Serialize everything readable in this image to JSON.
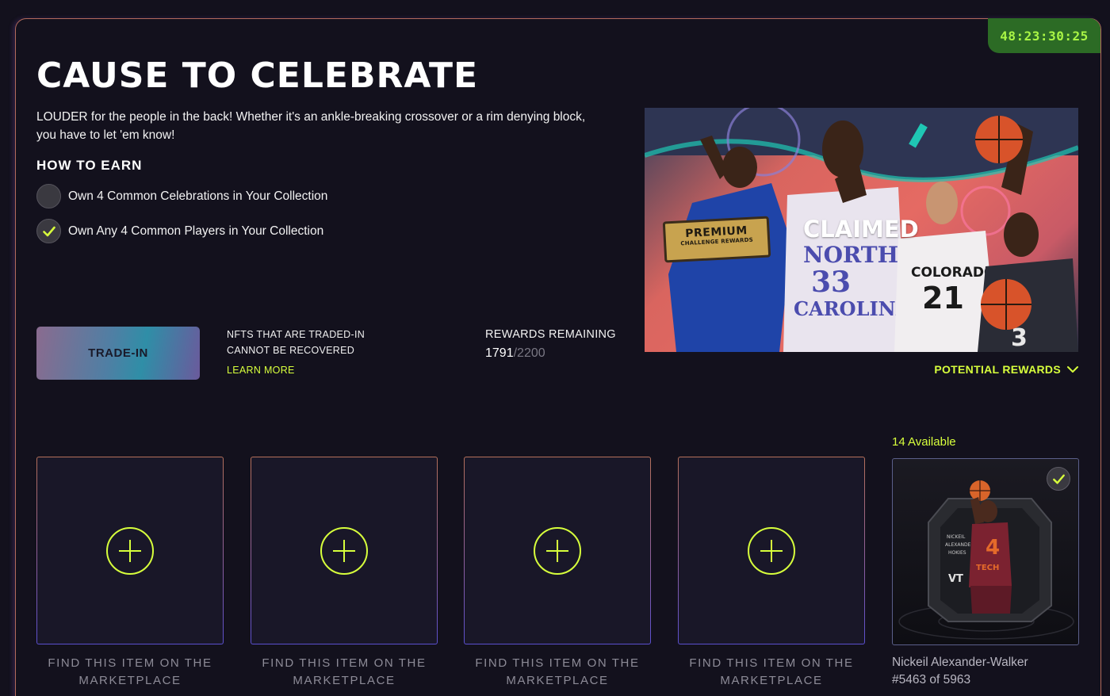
{
  "timer": "48:23:30:25",
  "title": "CAUSE TO CELEBRATE",
  "description": "LOUDER for the people in the back! Whether it's an ankle-breaking crossover or a rim denying block, you have to let 'em know!",
  "how_to_earn": {
    "heading": "HOW TO EARN",
    "requirements": [
      {
        "label": "Own 4 Common Celebrations in Your Collection",
        "completed": false
      },
      {
        "label": "Own Any 4 Common Players in Your Collection",
        "completed": true
      }
    ]
  },
  "trade_in": {
    "button_label": "TRADE-IN",
    "warning_line1": "NFTS THAT ARE TRADED-IN",
    "warning_line2": "CANNOT BE RECOVERED",
    "learn_more": "LEARN MORE"
  },
  "rewards": {
    "label": "REWARDS REMAINING",
    "remaining": "1791",
    "total": "/2200"
  },
  "hero": {
    "claimed_label": "CLAIMED",
    "premium_line1": "PREMIUM",
    "premium_line2": "CHALLENGE REWARDS",
    "jerseys": {
      "center_team": "NORTH CAROLINA",
      "center_number": "33",
      "right_team": "COLORADO",
      "right_number": "21",
      "far_right_number": "3"
    }
  },
  "potential_rewards": "POTENTIAL REWARDS",
  "slots": [
    {
      "caption_line1": "FIND THIS ITEM ON THE",
      "caption_line2": "MARKETPLACE"
    },
    {
      "caption_line1": "FIND THIS ITEM ON THE",
      "caption_line2": "MARKETPLACE"
    },
    {
      "caption_line1": "FIND THIS ITEM ON THE",
      "caption_line2": "MARKETPLACE"
    },
    {
      "caption_line1": "FIND THIS ITEM ON THE",
      "caption_line2": "MARKETPLACE"
    }
  ],
  "owned_card": {
    "available": "14 Available",
    "player_name": "Nickeil Alexander-Walker",
    "serial": "#5463 of 5963",
    "jersey_text": "TECH",
    "jersey_number": "4",
    "logo": "VT"
  },
  "colors": {
    "accent": "#d7ff3c",
    "timer_bg": "#2c6b25",
    "background": "#13111d"
  }
}
